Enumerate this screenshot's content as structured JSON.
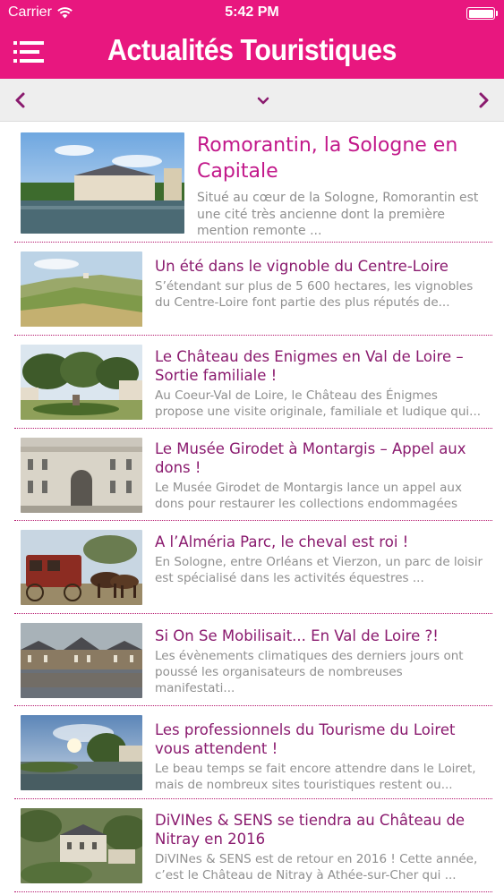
{
  "status_bar": {
    "carrier": "Carrier",
    "time": "5:42 PM"
  },
  "header": {
    "title": "Actualités Touristiques",
    "color": "#e8177f"
  },
  "articles": [
    {
      "headline": "Romorantin, la Sologne en Capitale",
      "summary": "Situé au cœur de la Sologne, Romorantin est une cité très ancienne dont la première mention remonte ..."
    },
    {
      "headline": "Un été dans le vignoble du Centre-Loire",
      "summary": "S’étendant sur plus de 5 600 hectares, les vignobles du Centre-Loire font partie des plus réputés de..."
    },
    {
      "headline": "Le Château des Enigmes en Val de Loire – Sortie familiale !",
      "summary": "Au Coeur-Val de Loire, le Château des Énigmes propose une visite originale, familiale et ludique qui..."
    },
    {
      "headline": "Le Musée Girodet à Montargis – Appel aux dons !",
      "summary": "Le Musée Girodet de Montargis lance un appel aux dons pour restaurer les collections endommagées"
    },
    {
      "headline": "A l’Alméria Parc, le cheval est roi !",
      "summary": "En Sologne, entre Orléans et Vierzon, un parc de loisir est spécialisé dans les activités équestres ..."
    },
    {
      "headline": "Si On Se Mobilisait... En Val de Loire ?!",
      "summary": "Les évènements climatiques des derniers jours ont poussé les organisateurs de nombreuses manifestati..."
    },
    {
      "headline": "Les professionnels du Tourisme du Loiret vous attendent !",
      "summary": "Le beau temps se fait encore attendre dans le Loiret, mais de nombreux sites touristiques restent ou..."
    },
    {
      "headline": "DiVINes & SENS se tiendra au Château de Nitray en 2016",
      "summary": "DiVINes & SENS est de retour en 2016 ! Cette année, c’est le Château de Nitray à Athée-sur-Cher qui ..."
    }
  ]
}
